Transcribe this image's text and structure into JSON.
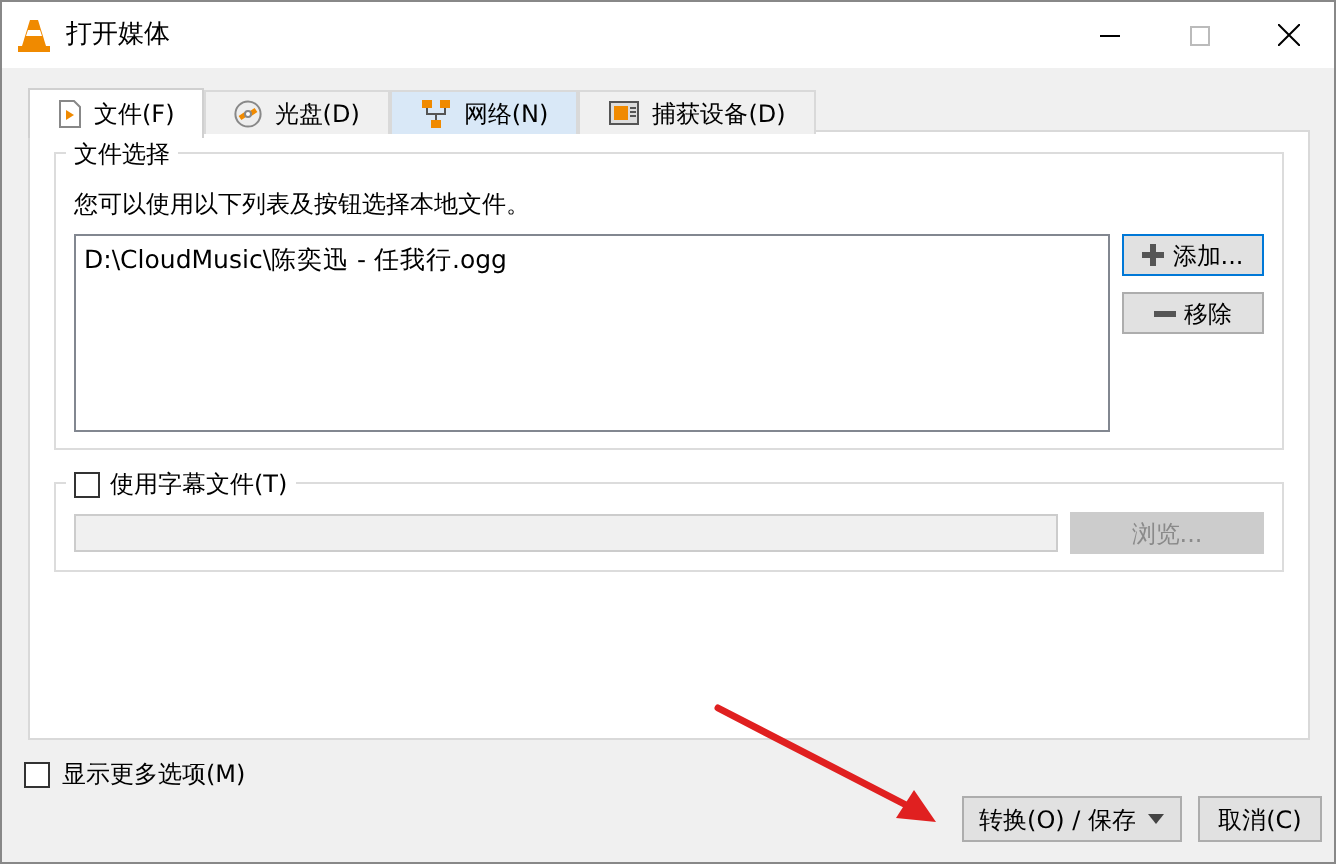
{
  "window": {
    "title": "打开媒体"
  },
  "tabs": [
    {
      "label": "文件(F)",
      "selected": true,
      "kind": "file"
    },
    {
      "label": "光盘(D)",
      "selected": false,
      "kind": "disc"
    },
    {
      "label": "网络(N)",
      "selected": false,
      "kind": "network"
    },
    {
      "label": "捕获设备(D)",
      "selected": false,
      "kind": "capture"
    }
  ],
  "file_selection": {
    "title": "文件选择",
    "hint": "您可以使用以下列表及按钮选择本地文件。",
    "files": [
      "D:\\CloudMusic\\陈奕迅 - 任我行.ogg"
    ],
    "add_button": "添加...",
    "remove_button": "移除"
  },
  "subtitle": {
    "label": "使用字幕文件(T)",
    "checked": false,
    "browse_button": "浏览..."
  },
  "show_more": {
    "label": "显示更多选项(M)",
    "checked": false
  },
  "buttons": {
    "convert": "转换(O) / 保存",
    "cancel": "取消(C)"
  }
}
